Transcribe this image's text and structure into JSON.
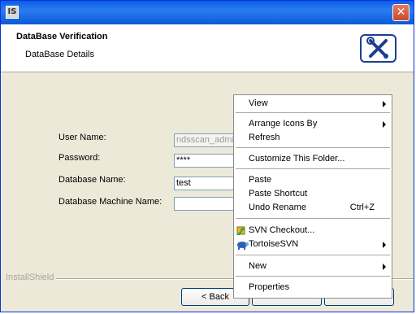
{
  "window": {
    "icon_text": "IS",
    "close_glyph": "✕"
  },
  "header": {
    "title": "DataBase Verification",
    "subtitle": "DataBase Details",
    "logo_icon": "tools-icon"
  },
  "form": {
    "user_name_label": "User Name:",
    "user_name_value": "ndsscan_admin",
    "password_label": "Password:",
    "password_value": "****",
    "database_name_label": "Database Name:",
    "database_name_value": "test",
    "machine_name_label": "Database Machine Name:",
    "machine_name_value": ""
  },
  "footer": {
    "brand": "InstallShield",
    "back_label": "< Back"
  },
  "context_menu": {
    "view": "View",
    "arrange_icons_by": "Arrange Icons By",
    "refresh": "Refresh",
    "customize_folder": "Customize This Folder...",
    "paste": "Paste",
    "paste_shortcut": "Paste Shortcut",
    "undo_rename": "Undo Rename",
    "undo_rename_shortcut": "Ctrl+Z",
    "svn_checkout": "SVN Checkout...",
    "tortoise_svn": "TortoiseSVN",
    "new": "New",
    "properties": "Properties"
  }
}
